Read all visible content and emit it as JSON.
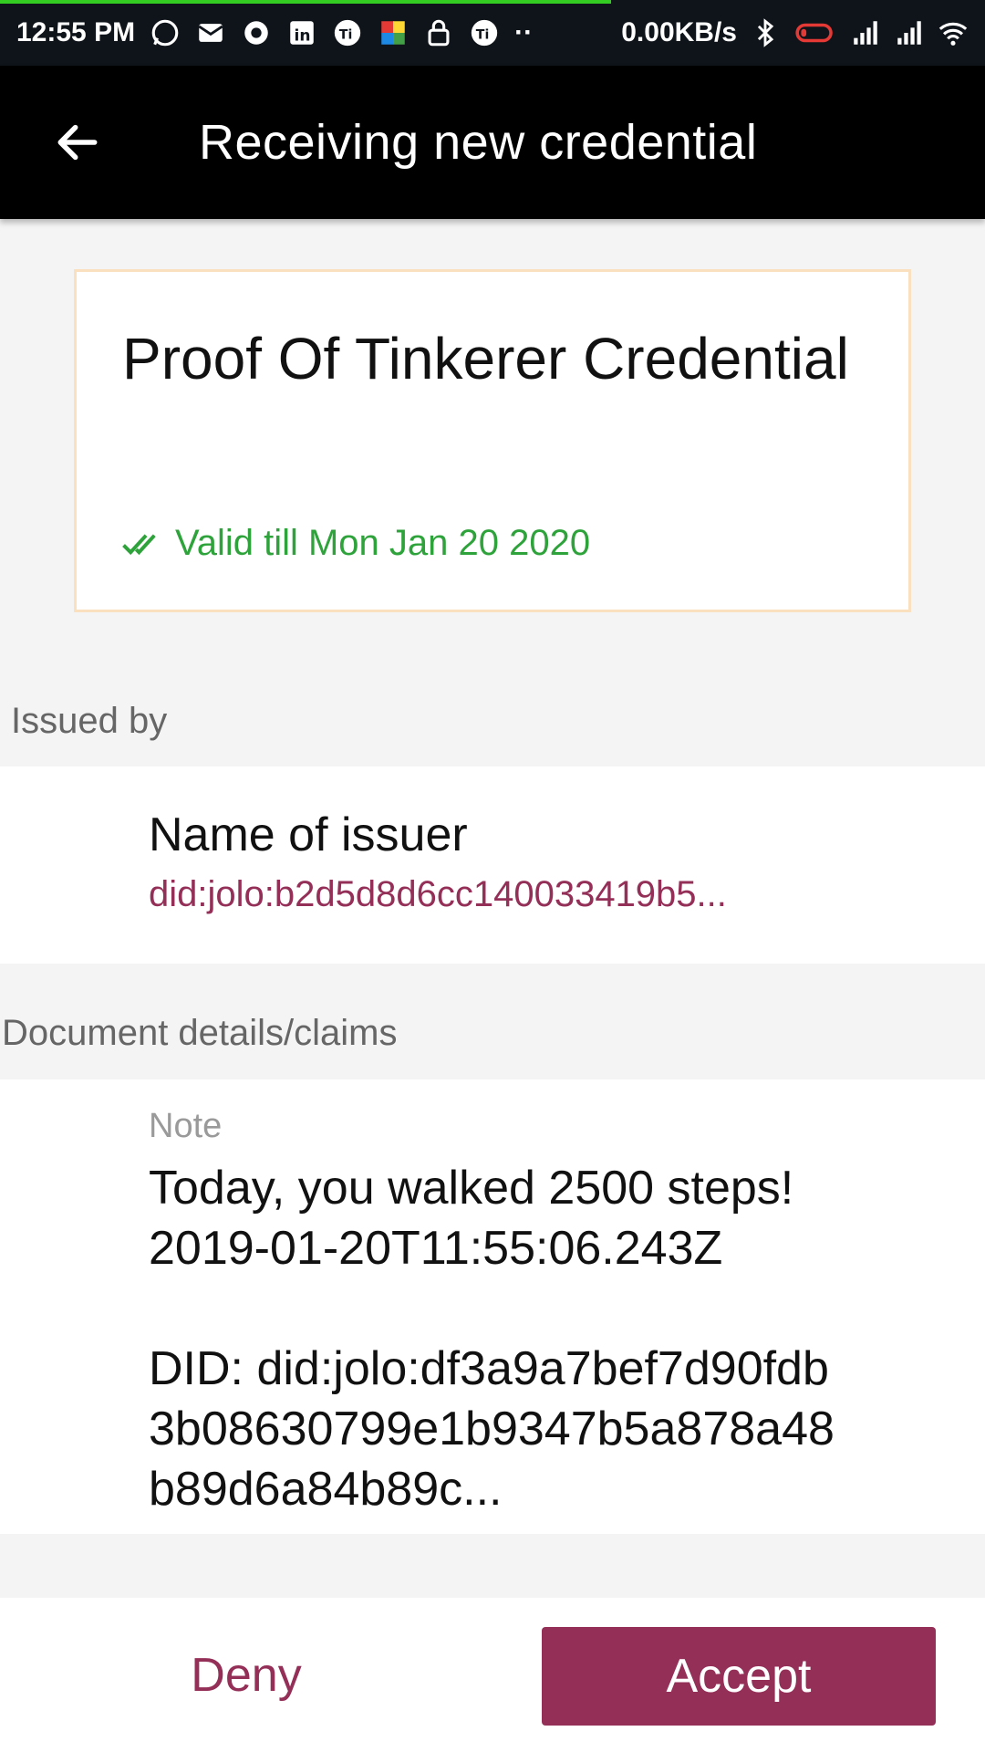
{
  "status_bar": {
    "time": "12:55 PM",
    "net_speed": "0.00KB/s",
    "progress": 0.62,
    "icons_left": [
      "whatsapp-icon",
      "mail-icon",
      "chrome-icon",
      "linkedin-icon",
      "ti-icon",
      "color-palette-icon",
      "lock-icon",
      "ti-icon",
      "more-dots-icon"
    ],
    "icons_right": [
      "bluetooth-icon",
      "battery-icon",
      "signal-icon",
      "signal-icon",
      "wifi-icon"
    ]
  },
  "app_bar": {
    "title": "Receiving new credential",
    "back_icon": "arrow-left-icon"
  },
  "credential": {
    "title": "Proof Of Tinkerer Credential",
    "validity": "Valid till Mon Jan 20 2020",
    "valid_icon": "double-check-icon"
  },
  "issued_by": {
    "section_label": "Issued by",
    "name": "Name of issuer",
    "did": "did:jolo:b2d5d8d6cc140033419b5..."
  },
  "claims": {
    "section_label": "Document details/claims",
    "label": "Note",
    "value": "Today, you walked 2500 steps!\n2019-01-20T11:55:06.243Z\n\nDID: did:jolo:df3a9a7bef7d90fdb3b08630799e1b9347b5a878a48b89d6a84b89c..."
  },
  "actions": {
    "deny": "Deny",
    "accept": "Accept"
  },
  "colors": {
    "accent": "#942f58",
    "valid": "#2fa33b",
    "card_border": "#fbe0bf"
  }
}
